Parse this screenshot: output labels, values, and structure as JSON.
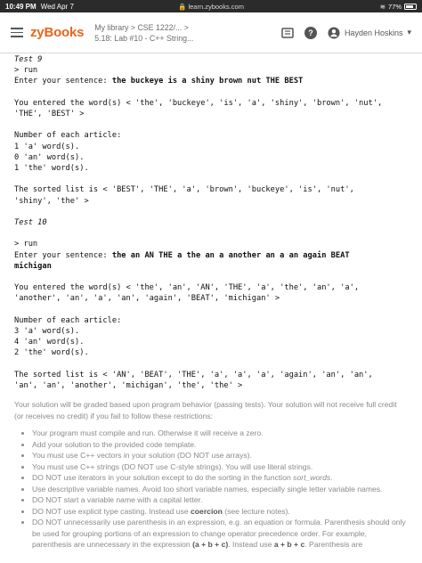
{
  "statusbar": {
    "time": "10:49 PM",
    "date": "Wed Apr 7",
    "url": "learn.zybooks.com",
    "wifi_icon": "wifi-icon",
    "battery": "77%"
  },
  "header": {
    "logo": "zyBooks",
    "breadcrumb_line1": "My library > CSE 1222/... >",
    "breadcrumb_line2": "5.18: Lab #10 - C++ String...",
    "user_name": "Hayden Hoskins",
    "icons": [
      "menu-icon",
      "book-icon",
      "help-icon",
      "user-icon",
      "caret-down-icon"
    ]
  },
  "tests": {
    "t9": {
      "title": "Test 9",
      "run": "> run",
      "prompt": "Enter your sentence: ",
      "input": "the buckeye is a shiny brown nut THE BEST",
      "entered1": "You entered the word(s) < 'the', 'buckeye', 'is', 'a', 'shiny', 'brown', 'nut',",
      "entered2": "'THE', 'BEST' >",
      "count_header": "Number of each article:",
      "count_a": "1 'a' word(s).",
      "count_an": "0 'an' word(s).",
      "count_the": "1 'the' word(s).",
      "sorted1": "The sorted list is < 'BEST', 'THE', 'a', 'brown', 'buckeye', 'is', 'nut',",
      "sorted2": "'shiny', 'the' >"
    },
    "t10": {
      "title": "Test 10",
      "run": "> run",
      "prompt": "Enter your sentence: ",
      "input1": "the an AN THE a the an a another an a an again BEAT",
      "input2": "michigan",
      "entered1": "You entered the word(s) < 'the', 'an', 'AN', 'THE', 'a', 'the', 'an', 'a',",
      "entered2": "'another', 'an', 'a', 'an', 'again', 'BEAT', 'michigan' >",
      "count_header": "Number of each article:",
      "count_a": "3 'a' word(s).",
      "count_an": "4 'an' word(s).",
      "count_the": "2 'the' word(s).",
      "sorted1": "The sorted list is < 'AN', 'BEAT', 'THE', 'a', 'a', 'a', 'again', 'an', 'an',",
      "sorted2": "'an', 'an', 'another', 'michigan', 'the', 'the' >"
    }
  },
  "rules": {
    "intro": "Your solution will be graded based upon program behavior (passing tests). Your solution will not receive full credit (or receives no credit) if you fail to follow these restrictions:",
    "r1": "Your program must compile and run. Otherwise it will receive a zero.",
    "r2": "Add your solution to the provided code template.",
    "r3": "You must use C++ vectors in your solution (DO NOT use arrays).",
    "r4": "You must use C++ strings (DO NOT use C-style strings). You will use literal strings.",
    "r5_a": "DO NOT use iterators in your solution except to do the sorting in the function ",
    "r5_b": "sort_words",
    "r5_c": ".",
    "r6": "Use descriptive variable names. Avoid too short variable names, especially single letter variable names.",
    "r7": "DO NOT start a variable name with a capital letter.",
    "r8_a": "DO NOT use explicit type casting. Instead use ",
    "r8_b": "coercion",
    "r8_c": " (see lecture notes).",
    "r9_a": "DO NOT unnecessarily use parenthesis in an expression, e.g. an equation or formula. Parenthesis should only be used for grouping portions of an expression to change operator precedence order. For example, parenthesis are unnecessary in the expression ",
    "r9_b": "(a + b + c)",
    "r9_c": ". Instead use ",
    "r9_d": "a + b + c",
    "r9_e": ". Parenthesis are"
  }
}
